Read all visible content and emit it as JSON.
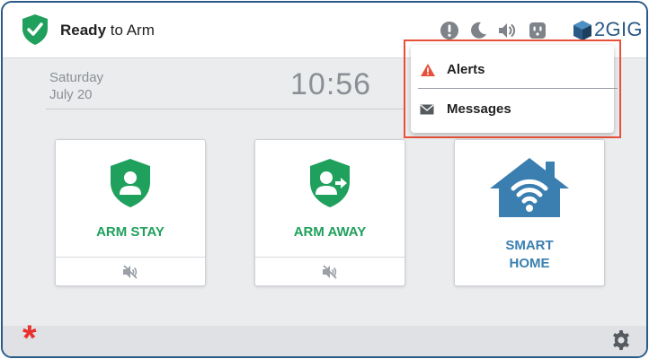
{
  "status": {
    "word_bold": "Ready",
    "word_rest": " to Arm",
    "color": "#1fa05d"
  },
  "top_icons": [
    "alert-icon",
    "night-mode-icon",
    "volume-icon",
    "outlet-icon"
  ],
  "brand": {
    "name": "2GIG",
    "color": "#2b5a86"
  },
  "date": {
    "day": "Saturday",
    "month_day": "July 20"
  },
  "clock": "10:56",
  "tiles": [
    {
      "label": "ARM STAY",
      "icon": "arm-stay-shield-icon",
      "color": "#1fa05d"
    },
    {
      "label": "ARM AWAY",
      "icon": "arm-away-shield-icon",
      "color": "#1fa05d"
    },
    {
      "label_line1": "SMART",
      "label_line2": "HOME",
      "icon": "smart-home-icon",
      "color": "#3b7fb0"
    }
  ],
  "dropdown": {
    "items": [
      {
        "label": "Alerts",
        "icon": "warning-triangle-icon",
        "color": "#e8503a"
      },
      {
        "label": "Messages",
        "icon": "envelope-icon"
      }
    ],
    "highlight_color": "#e8503a"
  },
  "bottom": {
    "emergency_icon": "emergency-asterisk-icon",
    "settings_icon": "gear-icon"
  }
}
